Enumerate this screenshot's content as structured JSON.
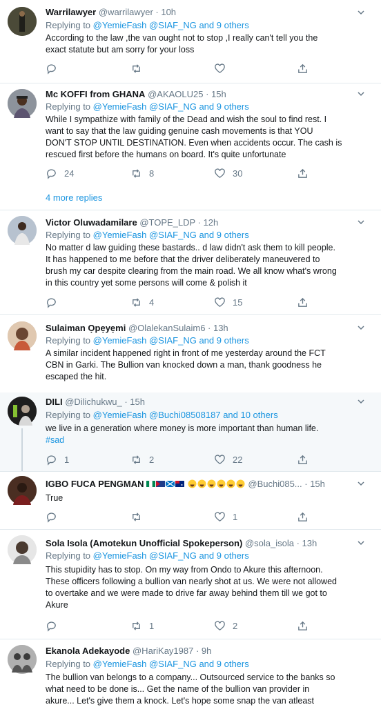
{
  "tweets": [
    {
      "name": "Warrilawyer",
      "handle": "@warrilawyer · 10h",
      "replying_prefix": "Replying to ",
      "replying_links": "@YemieFash @SIAF_NG and 9 others",
      "lines": [
        "According to the law ,the van ought not to stop ,I really can't tell you the",
        "exact statute but am sorry for your loss"
      ],
      "reply_count": "",
      "retweet_count": "",
      "like_count": ""
    },
    {
      "name": "Mc KOFFI from GHANA",
      "handle": "@AKAOLU25 · 15h",
      "replying_prefix": "Replying to ",
      "replying_links": "@YemieFash @SIAF_NG and 9 others",
      "lines": [
        "While I sympathize with family of the Dead and wish the soul to find rest.  I",
        "want to say that the law guiding genuine cash movements is that YOU",
        "DON'T STOP UNTIL DESTINATION. Even when accidents occur. The cash is",
        "rescued first before the humans on board. It's quite unfortunate"
      ],
      "reply_count": "24",
      "retweet_count": "8",
      "like_count": "30",
      "more_replies": "4 more replies"
    },
    {
      "name": "Victor Oluwadamilare",
      "handle": "@TOPE_LDP · 12h",
      "replying_prefix": "Replying to ",
      "replying_links": "@YemieFash @SIAF_NG and 9 others",
      "lines": [
        "No matter d law guiding these bastards.. d law didn't ask them to kill people.",
        "It has happened to me before that the driver deliberately maneuvered to",
        "brush my car despite clearing from the main road. We all know what's wrong",
        "in this country yet some persons will come & polish it"
      ],
      "reply_count": "",
      "retweet_count": "4",
      "like_count": "15"
    },
    {
      "name": "Sulaiman Ọpẹyẹmi",
      "handle": "@OlalekanSulaim6 · 13h",
      "replying_prefix": "Replying to ",
      "replying_links": "@YemieFash @SIAF_NG and 9 others",
      "lines": [
        "A similar incident happened right in front of me yesterday around the FCT",
        "CBN in Garki. The Bullion van knocked down a man, thank goodness he",
        "escaped the hit."
      ]
    },
    {
      "name": "DILI",
      "handle": "@Dilichukwu_ · 15h",
      "replying_prefix": "Replying to ",
      "replying_links": "@YemieFash @Buchi08508187 and 10 others",
      "lines": [
        "we live in a generation where money is more important than human life."
      ],
      "hashtag": "#sad",
      "reply_count": "1",
      "retweet_count": "2",
      "like_count": "22"
    },
    {
      "name": "IGBO FUCA PENGMAN",
      "handle": "@Buchi085... · 15h",
      "lines": [
        "True"
      ],
      "reply_count": "",
      "retweet_count": "",
      "like_count": "1"
    },
    {
      "name": "Sola Isola (Amotekun Unofficial Spokeperson)",
      "handle": "@sola_isola · 13h",
      "replying_prefix": "Replying to ",
      "replying_links": "@YemieFash @SIAF_NG and 9 others",
      "lines": [
        "This stupidity has to stop. On my way from Ondo to Akure this afternoon.",
        "These officers following a bullion van nearly shot at us. We were not allowed",
        "to overtake and we were made to drive far away behind them till we got to",
        "Akure"
      ],
      "reply_count": "",
      "retweet_count": "1",
      "like_count": "2"
    },
    {
      "name": "Ekanola Adekayode",
      "handle": "@HariKay1987 · 9h",
      "replying_prefix": "Replying to ",
      "replying_links": "@YemieFash @SIAF_NG and 9 others",
      "lines": [
        "The bullion van belongs to a company... Outsourced service to the banks so",
        "what need to be done is... Get the name of the bullion van provider in",
        "akure... Let's give them a knock. Let's hope some snap the van atleast"
      ]
    }
  ],
  "colors": {
    "link": "#1b95e0",
    "muted": "#657786",
    "text": "#14171a",
    "highlight": "#f5f8fa",
    "border": "#e1e8ed"
  }
}
